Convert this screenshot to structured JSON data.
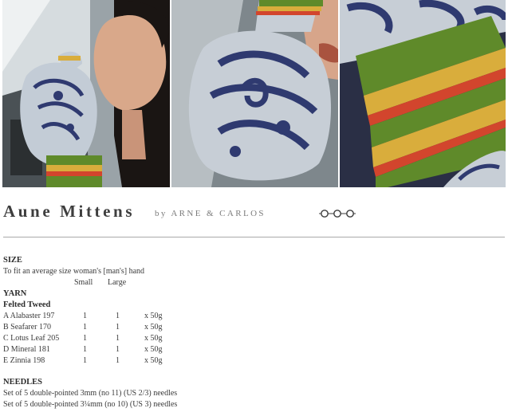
{
  "pattern": {
    "title": "Aune Mittens",
    "byline": "by ARNE & CARLOS",
    "rating": {
      "level": 3,
      "max": 3,
      "icon": "skill-level-ring-icon"
    }
  },
  "size": {
    "heading": "SIZE",
    "fit": "To fit an average size woman's [man's] hand",
    "columns": [
      "Small",
      "Large"
    ]
  },
  "yarn": {
    "heading": "YARN",
    "brand": "Felted Tweed",
    "rows": [
      {
        "label": "A Alabaster 197",
        "small": "1",
        "large": "1",
        "qty": "x 50g"
      },
      {
        "label": "B Seafarer 170",
        "small": "1",
        "large": "1",
        "qty": "x 50g"
      },
      {
        "label": "C Lotus Leaf 205",
        "small": "1",
        "large": "1",
        "qty": "x 50g"
      },
      {
        "label": "D Mineral 181",
        "small": "1",
        "large": "1",
        "qty": "x 50g"
      },
      {
        "label": "E Zinnia 198",
        "small": "1",
        "large": "1",
        "qty": "x 50g"
      }
    ]
  },
  "needles": {
    "heading": "NEEDLES",
    "lines": [
      "Set of 5 double-pointed 3mm (no 11) (US 2/3) needles",
      "Set of 5 double-pointed 3¼mm (no 10) (US 3) needles"
    ]
  },
  "colors": {
    "navy": "#2f3a70",
    "pale": "#c7ced6",
    "green": "#5f8a2a",
    "yellow": "#d9ad3c",
    "red": "#d2452d"
  }
}
